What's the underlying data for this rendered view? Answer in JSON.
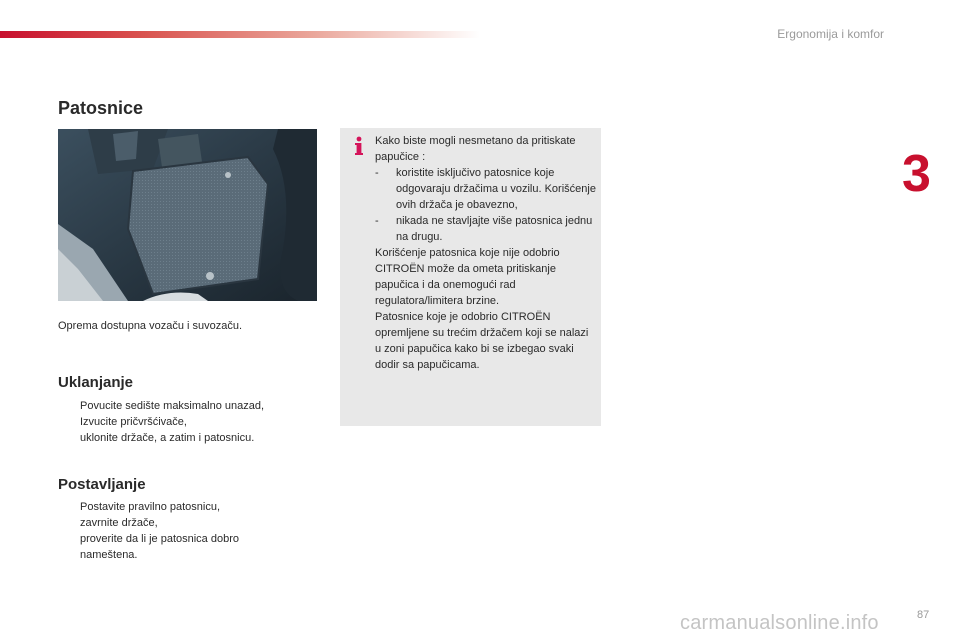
{
  "header": {
    "section": "Ergonomija i komfor",
    "chapter": "3"
  },
  "page": {
    "number": "87",
    "watermark": "carmanualsonline.info"
  },
  "title": "Patosnice",
  "photo_caption": "Oprema dostupna vozaču i suvozaču.",
  "removal": {
    "heading": "Uklanjanje",
    "steps": [
      "Povucite sedište maksimalno unazad,",
      "Izvucite pričvršćivače,",
      "uklonite držače, a zatim i patosnicu."
    ]
  },
  "installation": {
    "heading": "Postavljanje",
    "steps": [
      "Postavite pravilno patosnicu,",
      "zavrnite držače,",
      "proverite da li je patosnica dobro nameštena."
    ]
  },
  "info": {
    "intro": "Kako biste mogli nesmetano da pritiskate papučice :",
    "items": [
      "koristite isključivo patosnice koje odgovaraju držačima u vozilu. Korišćenje ovih držača je obavezno,",
      "nikada ne stavljajte više patosnica jednu na drugu."
    ],
    "para1": "Korišćenje patosnica koje nije odobrio CITROËN može da ometa pritiskanje papučica i da onemogući rad regulatora/limitera brzine.",
    "para2": "Patosnice koje je odobrio CITROËN opremljene su trećim držačem koji se nalazi u zoni papučica kako bi se izbegao svaki dodir sa papučicama."
  },
  "bullet_symbol": "",
  "dash_symbol": "-",
  "colors": {
    "accent": "#c8102e",
    "info_bg": "#e8e8e8",
    "muted": "#9a9a9a"
  },
  "icons": {
    "info": "info-icon",
    "photo": "floor-mat-photo"
  }
}
